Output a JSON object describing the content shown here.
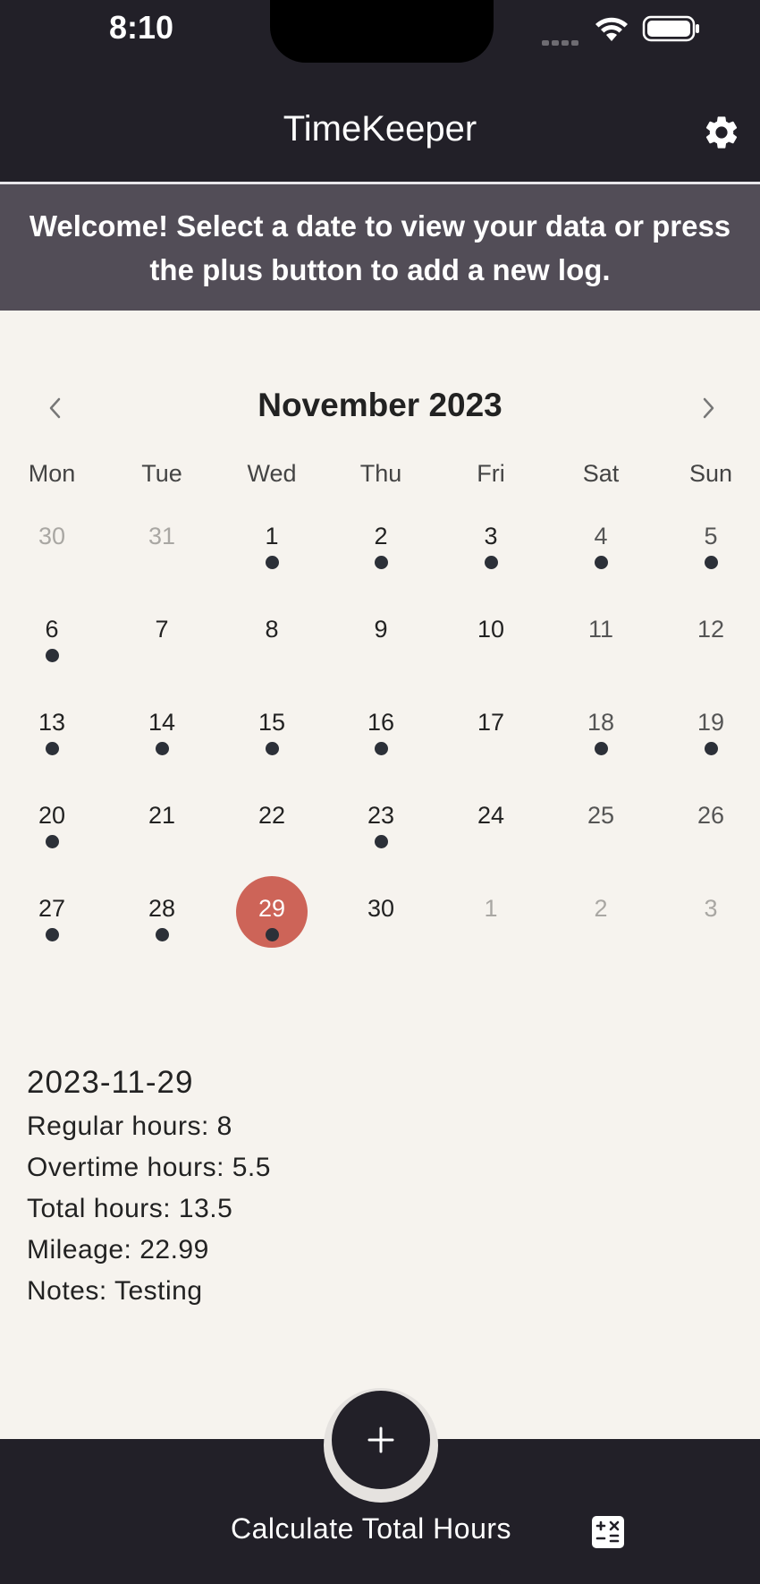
{
  "status_bar": {
    "time": "8:10"
  },
  "header": {
    "title": "TimeKeeper",
    "settings_icon": "gear-icon"
  },
  "banner": {
    "text": "Welcome! Select a date to view your data or press the plus button to add a new log."
  },
  "calendar": {
    "month_label": "November 2023",
    "weekdays": [
      "Mon",
      "Tue",
      "Wed",
      "Thu",
      "Fri",
      "Sat",
      "Sun"
    ],
    "weeks": [
      [
        {
          "day": "30",
          "muted": true,
          "dot": false
        },
        {
          "day": "31",
          "muted": true,
          "dot": false
        },
        {
          "day": "1",
          "dot": true
        },
        {
          "day": "2",
          "dot": true
        },
        {
          "day": "3",
          "dot": true
        },
        {
          "day": "4",
          "dot": true
        },
        {
          "day": "5",
          "dot": true
        }
      ],
      [
        {
          "day": "6",
          "dot": true
        },
        {
          "day": "7",
          "dot": false
        },
        {
          "day": "8",
          "dot": false
        },
        {
          "day": "9",
          "dot": false
        },
        {
          "day": "10",
          "dot": false
        },
        {
          "day": "11",
          "dot": false
        },
        {
          "day": "12",
          "dot": false
        }
      ],
      [
        {
          "day": "13",
          "dot": true
        },
        {
          "day": "14",
          "dot": true
        },
        {
          "day": "15",
          "dot": true
        },
        {
          "day": "16",
          "dot": true
        },
        {
          "day": "17",
          "dot": false
        },
        {
          "day": "18",
          "dot": true
        },
        {
          "day": "19",
          "dot": true
        }
      ],
      [
        {
          "day": "20",
          "dot": true
        },
        {
          "day": "21",
          "dot": false
        },
        {
          "day": "22",
          "dot": false
        },
        {
          "day": "23",
          "dot": true
        },
        {
          "day": "24",
          "dot": false
        },
        {
          "day": "25",
          "dot": false
        },
        {
          "day": "26",
          "dot": false
        }
      ],
      [
        {
          "day": "27",
          "dot": true
        },
        {
          "day": "28",
          "dot": true
        },
        {
          "day": "29",
          "dot": true,
          "selected": true
        },
        {
          "day": "30",
          "dot": false
        },
        {
          "day": "1",
          "muted": true,
          "dot": false
        },
        {
          "day": "2",
          "muted": true,
          "dot": false
        },
        {
          "day": "3",
          "muted": true,
          "dot": false
        }
      ]
    ],
    "selected_color": "#cd6458"
  },
  "details": {
    "date": "2023-11-29",
    "regular": "Regular hours: 8",
    "overtime": "Overtime hours: 5.5",
    "total": "Total hours: 13.5",
    "mileage": "Mileage: 22.99",
    "notes": "Notes: Testing"
  },
  "bottom": {
    "fab_icon": "plus-icon",
    "calc_label": "Calculate Total Hours",
    "calc_icon": "calculator-icon"
  }
}
